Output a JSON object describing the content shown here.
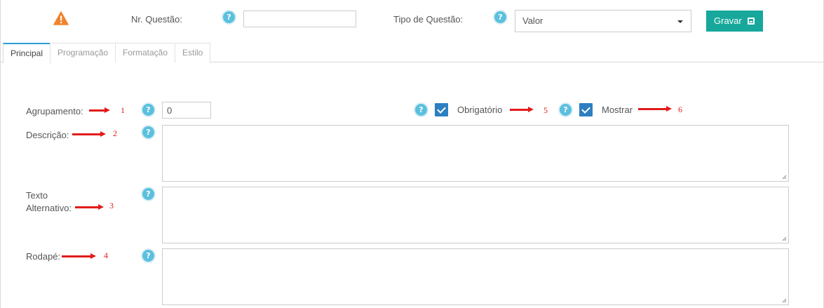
{
  "header": {
    "warning_icon": "warning-icon",
    "question_number_label": "Nr. Questão:",
    "question_number_value": "",
    "question_type_label": "Tipo de Questão:",
    "question_type_value": "Valor",
    "save_label": "Gravar",
    "help_symbol": "?"
  },
  "tabs": [
    {
      "label": "Principal",
      "active": true
    },
    {
      "label": "Programação",
      "active": false
    },
    {
      "label": "Formatação",
      "active": false
    },
    {
      "label": "Estilo",
      "active": false
    }
  ],
  "form": {
    "grouping_label": "Agrupamento:",
    "grouping_value": "0",
    "required_label": "Obrigatório",
    "required_checked": true,
    "show_label": "Mostrar",
    "show_checked": true,
    "description_label": "Descrição:",
    "alt_text_label_line1": "Texto",
    "alt_text_label_line2": "Alternativo:",
    "footer_label": "Rodapé:"
  },
  "annotations": [
    "1",
    "2",
    "3",
    "4",
    "5",
    "6"
  ],
  "colors": {
    "accent_button": "#17a89b",
    "help_icon": "#5bc0de",
    "checkbox": "#2d7fc0",
    "annotation_arrow": "#e21b1b",
    "warning": "#f0842c"
  }
}
